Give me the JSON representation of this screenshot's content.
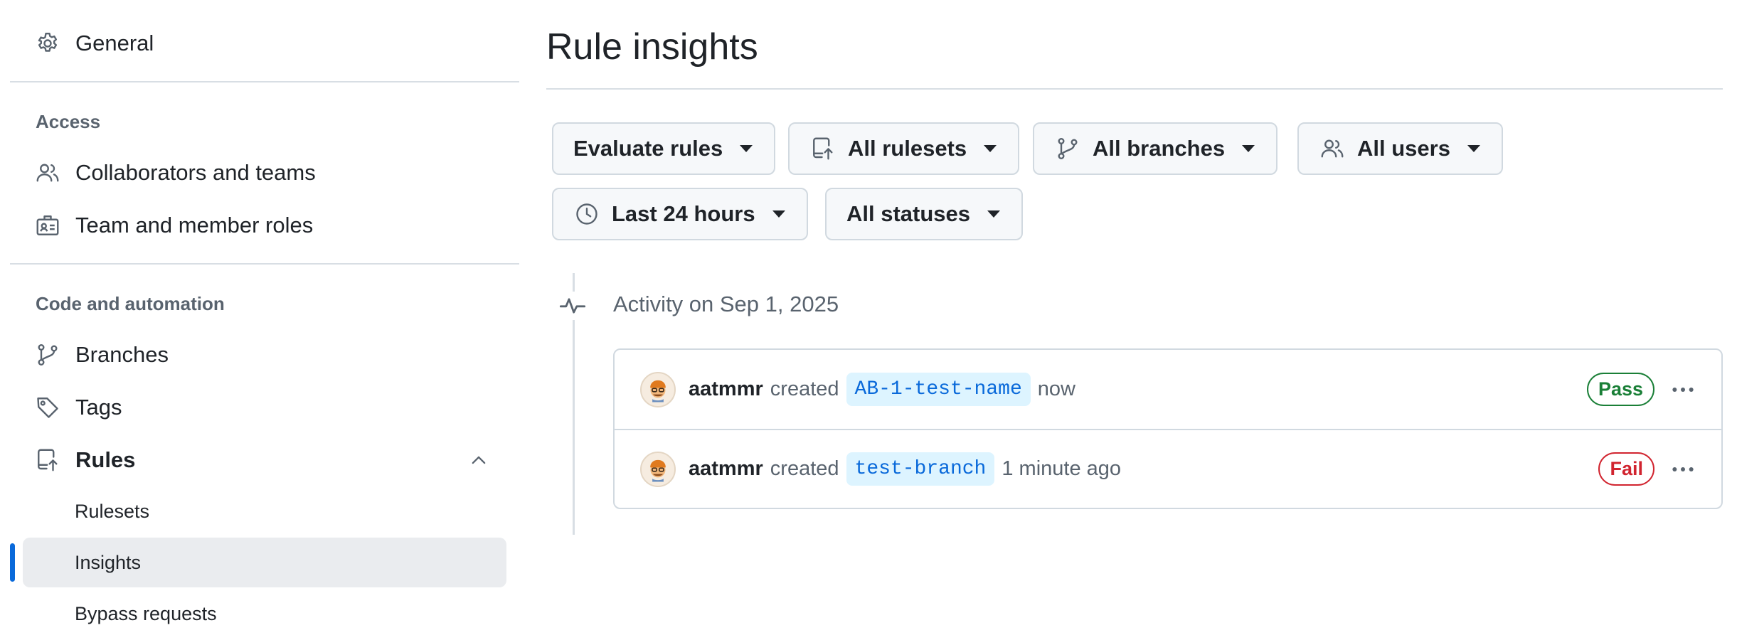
{
  "sidebar": {
    "general": "General",
    "access_heading": "Access",
    "collaborators": "Collaborators and teams",
    "member_roles": "Team and member roles",
    "code_heading": "Code and automation",
    "branches": "Branches",
    "tags": "Tags",
    "rules": "Rules",
    "rulesets": "Rulesets",
    "insights": "Insights",
    "bypass": "Bypass requests"
  },
  "main": {
    "title": "Rule insights",
    "filters": {
      "evaluate": "Evaluate rules",
      "rulesets": "All rulesets",
      "branches": "All branches",
      "users": "All users",
      "time": "Last 24 hours",
      "statuses": "All statuses"
    },
    "activity_heading": "Activity on Sep 1, 2025",
    "rows": [
      {
        "user": "aatmmr",
        "verb": "created",
        "branch": "AB-1-test-name",
        "time": "now",
        "status": "Pass"
      },
      {
        "user": "aatmmr",
        "verb": "created",
        "branch": "test-branch",
        "time": "1 minute ago",
        "status": "Fail"
      }
    ]
  },
  "colors": {
    "accent": "#0969da",
    "pass": "#1a7f37",
    "fail": "#d1242f"
  },
  "icons": {
    "general": "gear-icon",
    "collaborators": "people-icon",
    "member_roles": "id-badge-icon",
    "branches": "git-branch-icon",
    "tags": "tag-icon",
    "rules": "repo-push-icon",
    "rules_toggle": "chevron-up-icon",
    "time": "clock-icon",
    "activity": "pulse-icon",
    "row_menu": "kebab-horizontal-icon"
  }
}
